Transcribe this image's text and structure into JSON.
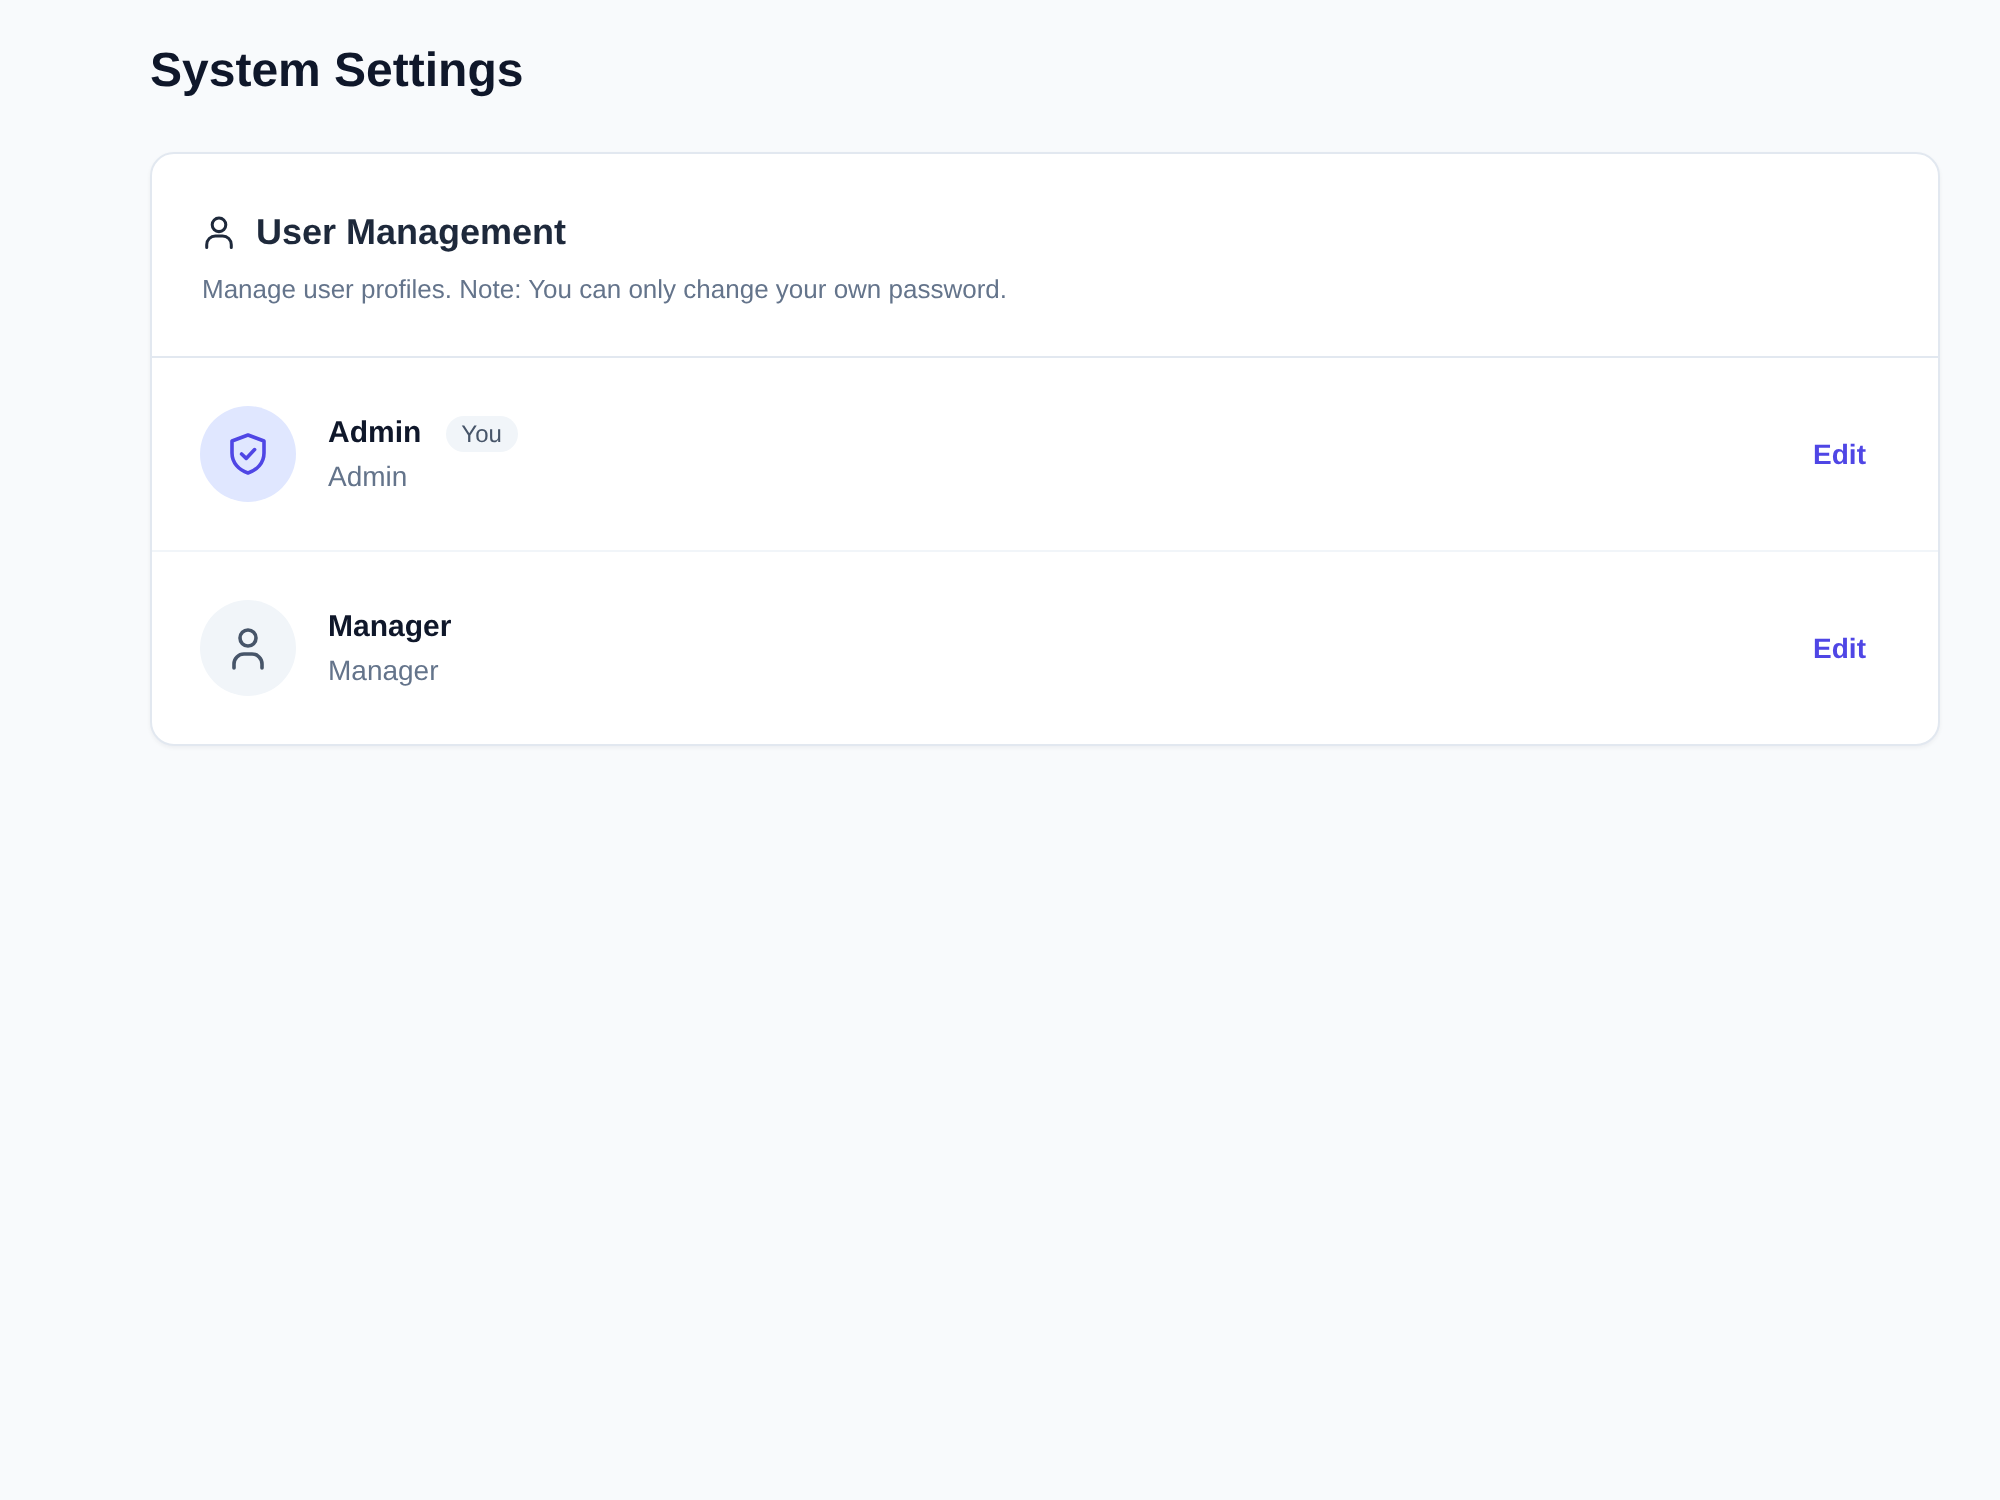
{
  "page": {
    "title": "System Settings"
  },
  "section": {
    "title": "User Management",
    "description": "Manage user profiles. Note: You can only change your own password."
  },
  "users": [
    {
      "kind": "admin",
      "name": "Admin",
      "badge": "You",
      "role": "Admin",
      "action": "Edit"
    },
    {
      "kind": "user",
      "name": "Manager",
      "role": "Manager",
      "action": "Edit"
    }
  ]
}
